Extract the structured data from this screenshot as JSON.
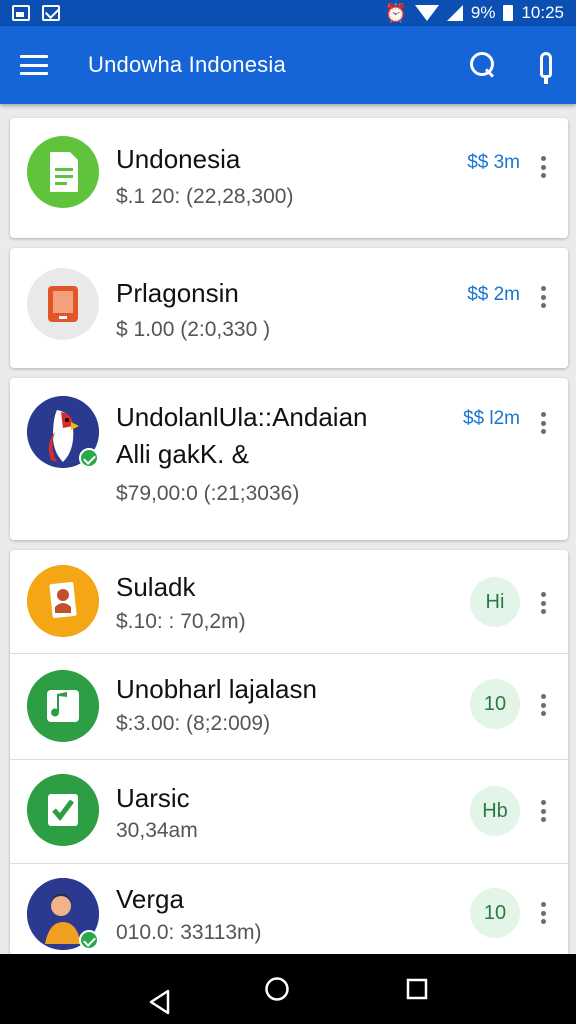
{
  "status_bar": {
    "percent": "9%",
    "time": "10:25"
  },
  "app_bar": {
    "title": "Undowha Indonesia"
  },
  "items": [
    {
      "title": "Undonesia",
      "subtitle": "$.1 20: (22,28,300)",
      "amount": "$$ 3m",
      "avatar_color": "#5fc43b"
    },
    {
      "title": "Prlagonsin",
      "subtitle": "$ 1.00  (2:0,330 )",
      "amount": "$$ 2m",
      "avatar_color": "#e9e9e9"
    },
    {
      "title": "UndolanlUla::Andaian",
      "title2": "Alli gakK. &",
      "subtitle": "$79,00:0 (:21;3036)",
      "amount": "$$ l2m",
      "avatar_color": "#2b3a8e"
    },
    {
      "title": "Suladk",
      "subtitle": "$.10: :  70,2m)",
      "badge": "Hi",
      "avatar_color": "#f5a614"
    },
    {
      "title": "Unobharl lajalasn",
      "subtitle": "$:3.00: (8;2:009)",
      "badge": "10",
      "avatar_color": "#2e9e44"
    },
    {
      "title": "Uarsic",
      "subtitle": "30,34am",
      "badge": "Hb",
      "avatar_color": "#2e9e44"
    },
    {
      "title": "Verga",
      "subtitle": "010.0: 33113m)",
      "badge": "10",
      "avatar_color": "#2b3a8e"
    }
  ],
  "icons": {
    "menu": "hamburger-icon",
    "search": "search-icon",
    "more": "more-icon",
    "back": "back-icon",
    "home": "home-icon",
    "recents": "recents-icon"
  }
}
